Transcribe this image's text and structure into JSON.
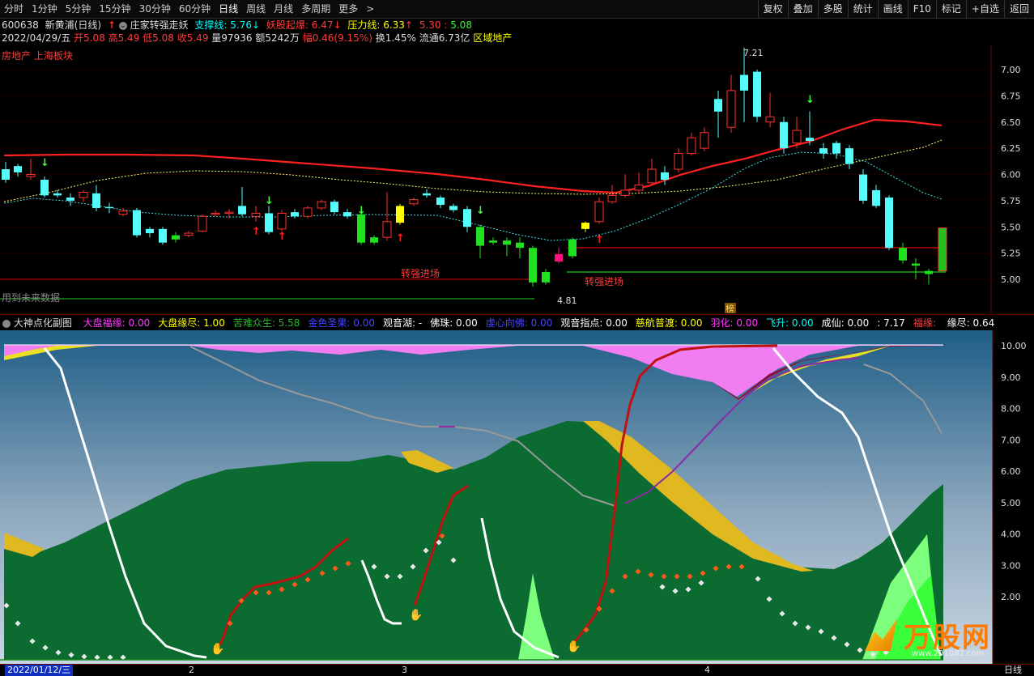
{
  "periods": [
    "分时",
    "1分钟",
    "5分钟",
    "15分钟",
    "30分钟",
    "60分钟",
    "日线",
    "周线",
    "月线",
    "多周期",
    "更多"
  ],
  "active_period": "日线",
  "more_arrow": ">",
  "toolbar": [
    "复权",
    "叠加",
    "多股",
    "统计",
    "画线",
    "F10",
    "标记",
    "+自选",
    "返回"
  ],
  "stock": {
    "code": "600638",
    "name": "新黄浦(日线)",
    "formula": "庄家转强走妖",
    "support": "支撑线: 5.76",
    "yao": "妖股起爆: 6.47",
    "pressure": "压力线: 6.33",
    "sig1": "5.30",
    "sig2": "5.08"
  },
  "quote": {
    "date": "2022/04/29/五",
    "open": "开5.08",
    "high": "高5.49",
    "low": "低5.08",
    "close": "收5.49",
    "vol": "量97936",
    "amount": "额5242万",
    "change": "幅0.46(9.15%)",
    "turnover": "换1.45%",
    "float": "流通6.73亿",
    "region": "区域地产"
  },
  "sector": "房地产 上海板块",
  "main_chart": {
    "y_ticks": [
      "7.00",
      "6.75",
      "6.50",
      "6.25",
      "6.00",
      "5.75",
      "5.50",
      "5.25",
      "5.00"
    ],
    "high_label": "7.21",
    "low_label": "4.81",
    "signal_label": "转强进场",
    "note": "用到未来数据",
    "rank_badge": "榜"
  },
  "indicator": {
    "title": "大神点化副图",
    "items": [
      {
        "text": "大盘福缘: 0.00",
        "color": "#ff3bff"
      },
      {
        "text": "大盘缘尽: 1.00",
        "color": "#ffff00"
      },
      {
        "text": "苦难众生: 5.58",
        "color": "#2db52d"
      },
      {
        "text": "金色圣果: 0.00",
        "color": "#4444ff"
      },
      {
        "text": "观音湖: -",
        "color": "#ffffff"
      },
      {
        "text": "佛珠: 0.00",
        "color": "#ffffff"
      },
      {
        "text": "虔心向佛: 0.00",
        "color": "#4444ff"
      },
      {
        "text": "观音指点: 0.00",
        "color": "#ffffff"
      },
      {
        "text": "慈航普渡: 0.00",
        "color": "#ffff00"
      },
      {
        "text": "羽化: 0.00",
        "color": "#ff3bff"
      },
      {
        "text": "飞升: 0.00",
        "color": "#00ffff"
      },
      {
        "text": "成仙: 0.00",
        "color": "#ffffff"
      },
      {
        "text": ": 7.17",
        "color": "#ffffff"
      },
      {
        "text": "福缘: ",
        "color": "#ff3b3b"
      },
      {
        "text": "缘尽: 0.64",
        "color": "#ffffff"
      }
    ],
    "y_ticks": [
      "10.00",
      "9.00",
      "8.00",
      "7.00",
      "6.00",
      "5.00",
      "4.00",
      "3.00",
      "2.00"
    ]
  },
  "x_axis": {
    "date": "2022/01/12/三",
    "ticks": [
      "2",
      "3",
      "4"
    ],
    "period": "日线"
  },
  "watermark": {
    "brand": "万股网",
    "url": "www.201082.com"
  }
}
